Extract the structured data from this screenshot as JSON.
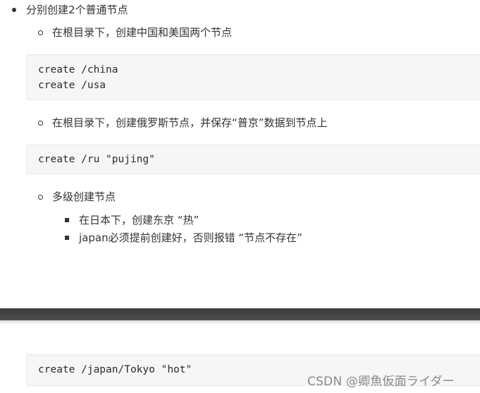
{
  "list": {
    "item1": "分别创建2个普通节点",
    "sub1": "在根目录下，创建中国和美国两个节点",
    "code1": [
      "create /china",
      "create /usa"
    ],
    "sub2": "在根目录下，创建俄罗斯节点，并保存“普京”数据到节点上",
    "code2": [
      "create /ru \"pujing\""
    ],
    "sub3": "多级创建节点",
    "sub3_items": [
      "在日本下，创建东京 “热”",
      "japan必须提前创建好，否则报错 “节点不存在”"
    ],
    "code3": [
      "create /japan/Tokyo \"hot\""
    ]
  },
  "watermark": "CSDN @卿魚仮面ライダー"
}
